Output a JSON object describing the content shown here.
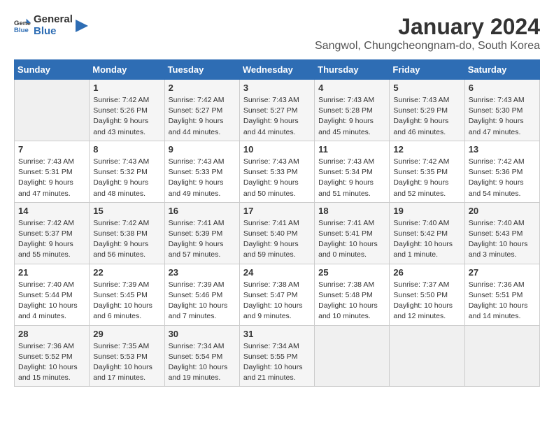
{
  "header": {
    "logo_general": "General",
    "logo_blue": "Blue",
    "title": "January 2024",
    "subtitle": "Sangwol, Chungcheongnam-do, South Korea"
  },
  "calendar": {
    "days_of_week": [
      "Sunday",
      "Monday",
      "Tuesday",
      "Wednesday",
      "Thursday",
      "Friday",
      "Saturday"
    ],
    "weeks": [
      [
        {
          "day": "",
          "sunrise": "",
          "sunset": "",
          "daylight": ""
        },
        {
          "day": "1",
          "sunrise": "Sunrise: 7:42 AM",
          "sunset": "Sunset: 5:26 PM",
          "daylight": "Daylight: 9 hours and 43 minutes."
        },
        {
          "day": "2",
          "sunrise": "Sunrise: 7:42 AM",
          "sunset": "Sunset: 5:27 PM",
          "daylight": "Daylight: 9 hours and 44 minutes."
        },
        {
          "day": "3",
          "sunrise": "Sunrise: 7:43 AM",
          "sunset": "Sunset: 5:27 PM",
          "daylight": "Daylight: 9 hours and 44 minutes."
        },
        {
          "day": "4",
          "sunrise": "Sunrise: 7:43 AM",
          "sunset": "Sunset: 5:28 PM",
          "daylight": "Daylight: 9 hours and 45 minutes."
        },
        {
          "day": "5",
          "sunrise": "Sunrise: 7:43 AM",
          "sunset": "Sunset: 5:29 PM",
          "daylight": "Daylight: 9 hours and 46 minutes."
        },
        {
          "day": "6",
          "sunrise": "Sunrise: 7:43 AM",
          "sunset": "Sunset: 5:30 PM",
          "daylight": "Daylight: 9 hours and 47 minutes."
        }
      ],
      [
        {
          "day": "7",
          "sunrise": "Sunrise: 7:43 AM",
          "sunset": "Sunset: 5:31 PM",
          "daylight": "Daylight: 9 hours and 47 minutes."
        },
        {
          "day": "8",
          "sunrise": "Sunrise: 7:43 AM",
          "sunset": "Sunset: 5:32 PM",
          "daylight": "Daylight: 9 hours and 48 minutes."
        },
        {
          "day": "9",
          "sunrise": "Sunrise: 7:43 AM",
          "sunset": "Sunset: 5:33 PM",
          "daylight": "Daylight: 9 hours and 49 minutes."
        },
        {
          "day": "10",
          "sunrise": "Sunrise: 7:43 AM",
          "sunset": "Sunset: 5:33 PM",
          "daylight": "Daylight: 9 hours and 50 minutes."
        },
        {
          "day": "11",
          "sunrise": "Sunrise: 7:43 AM",
          "sunset": "Sunset: 5:34 PM",
          "daylight": "Daylight: 9 hours and 51 minutes."
        },
        {
          "day": "12",
          "sunrise": "Sunrise: 7:42 AM",
          "sunset": "Sunset: 5:35 PM",
          "daylight": "Daylight: 9 hours and 52 minutes."
        },
        {
          "day": "13",
          "sunrise": "Sunrise: 7:42 AM",
          "sunset": "Sunset: 5:36 PM",
          "daylight": "Daylight: 9 hours and 54 minutes."
        }
      ],
      [
        {
          "day": "14",
          "sunrise": "Sunrise: 7:42 AM",
          "sunset": "Sunset: 5:37 PM",
          "daylight": "Daylight: 9 hours and 55 minutes."
        },
        {
          "day": "15",
          "sunrise": "Sunrise: 7:42 AM",
          "sunset": "Sunset: 5:38 PM",
          "daylight": "Daylight: 9 hours and 56 minutes."
        },
        {
          "day": "16",
          "sunrise": "Sunrise: 7:41 AM",
          "sunset": "Sunset: 5:39 PM",
          "daylight": "Daylight: 9 hours and 57 minutes."
        },
        {
          "day": "17",
          "sunrise": "Sunrise: 7:41 AM",
          "sunset": "Sunset: 5:40 PM",
          "daylight": "Daylight: 9 hours and 59 minutes."
        },
        {
          "day": "18",
          "sunrise": "Sunrise: 7:41 AM",
          "sunset": "Sunset: 5:41 PM",
          "daylight": "Daylight: 10 hours and 0 minutes."
        },
        {
          "day": "19",
          "sunrise": "Sunrise: 7:40 AM",
          "sunset": "Sunset: 5:42 PM",
          "daylight": "Daylight: 10 hours and 1 minute."
        },
        {
          "day": "20",
          "sunrise": "Sunrise: 7:40 AM",
          "sunset": "Sunset: 5:43 PM",
          "daylight": "Daylight: 10 hours and 3 minutes."
        }
      ],
      [
        {
          "day": "21",
          "sunrise": "Sunrise: 7:40 AM",
          "sunset": "Sunset: 5:44 PM",
          "daylight": "Daylight: 10 hours and 4 minutes."
        },
        {
          "day": "22",
          "sunrise": "Sunrise: 7:39 AM",
          "sunset": "Sunset: 5:45 PM",
          "daylight": "Daylight: 10 hours and 6 minutes."
        },
        {
          "day": "23",
          "sunrise": "Sunrise: 7:39 AM",
          "sunset": "Sunset: 5:46 PM",
          "daylight": "Daylight: 10 hours and 7 minutes."
        },
        {
          "day": "24",
          "sunrise": "Sunrise: 7:38 AM",
          "sunset": "Sunset: 5:47 PM",
          "daylight": "Daylight: 10 hours and 9 minutes."
        },
        {
          "day": "25",
          "sunrise": "Sunrise: 7:38 AM",
          "sunset": "Sunset: 5:48 PM",
          "daylight": "Daylight: 10 hours and 10 minutes."
        },
        {
          "day": "26",
          "sunrise": "Sunrise: 7:37 AM",
          "sunset": "Sunset: 5:50 PM",
          "daylight": "Daylight: 10 hours and 12 minutes."
        },
        {
          "day": "27",
          "sunrise": "Sunrise: 7:36 AM",
          "sunset": "Sunset: 5:51 PM",
          "daylight": "Daylight: 10 hours and 14 minutes."
        }
      ],
      [
        {
          "day": "28",
          "sunrise": "Sunrise: 7:36 AM",
          "sunset": "Sunset: 5:52 PM",
          "daylight": "Daylight: 10 hours and 15 minutes."
        },
        {
          "day": "29",
          "sunrise": "Sunrise: 7:35 AM",
          "sunset": "Sunset: 5:53 PM",
          "daylight": "Daylight: 10 hours and 17 minutes."
        },
        {
          "day": "30",
          "sunrise": "Sunrise: 7:34 AM",
          "sunset": "Sunset: 5:54 PM",
          "daylight": "Daylight: 10 hours and 19 minutes."
        },
        {
          "day": "31",
          "sunrise": "Sunrise: 7:34 AM",
          "sunset": "Sunset: 5:55 PM",
          "daylight": "Daylight: 10 hours and 21 minutes."
        },
        {
          "day": "",
          "sunrise": "",
          "sunset": "",
          "daylight": ""
        },
        {
          "day": "",
          "sunrise": "",
          "sunset": "",
          "daylight": ""
        },
        {
          "day": "",
          "sunrise": "",
          "sunset": "",
          "daylight": ""
        }
      ]
    ]
  }
}
